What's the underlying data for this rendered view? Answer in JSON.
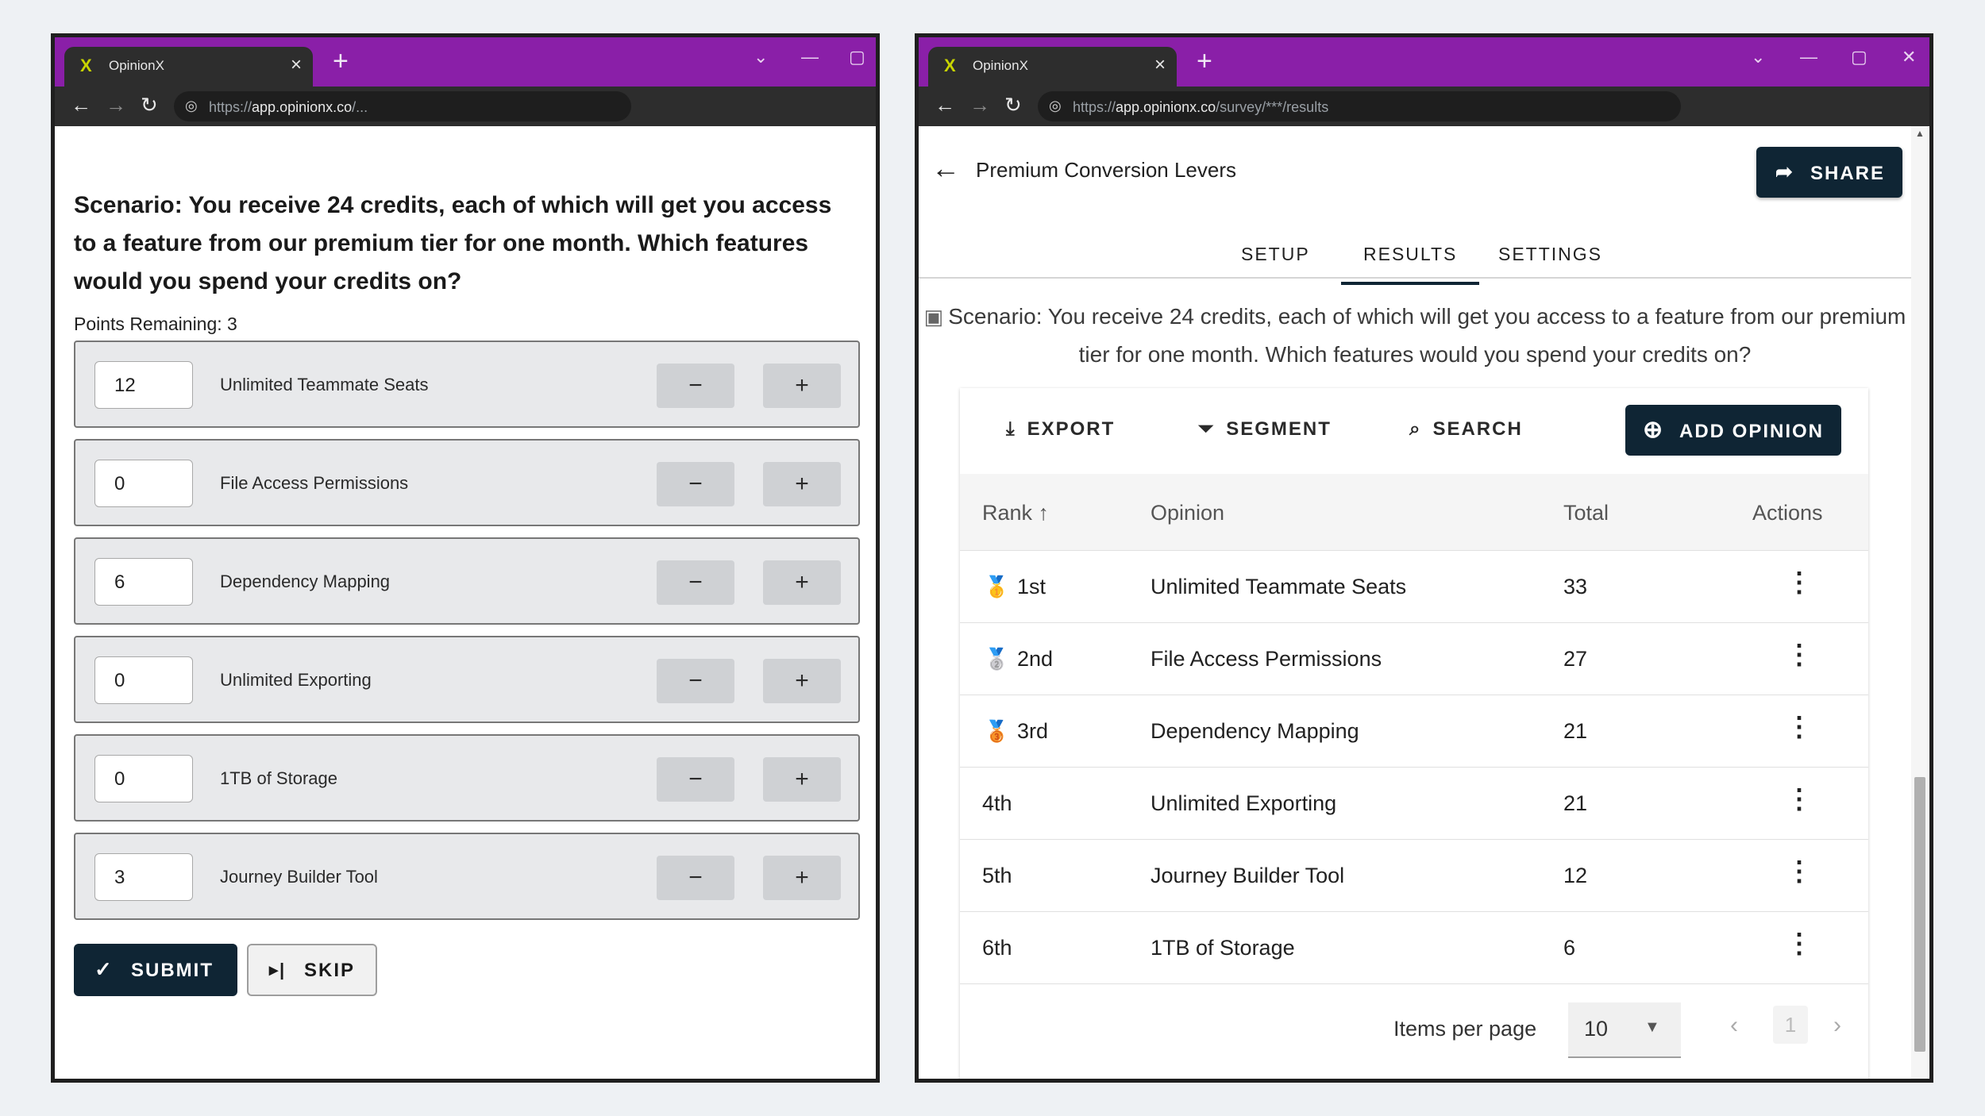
{
  "browser_left": {
    "tab_title": "OpinionX",
    "url_scheme": "https://",
    "url_host": "app.opinionx.co",
    "url_rest": "/..."
  },
  "survey": {
    "question": "Scenario: You receive 24 credits, each of which will get you access to a feature from our premium tier for one month. Which features would you spend your credits on?",
    "points_remaining": "Points Remaining: 3",
    "options": [
      {
        "value": "12",
        "label": "Unlimited Teammate Seats"
      },
      {
        "value": "0",
        "label": "File Access Permissions"
      },
      {
        "value": "6",
        "label": "Dependency Mapping"
      },
      {
        "value": "0",
        "label": "Unlimited Exporting"
      },
      {
        "value": "0",
        "label": "1TB of Storage"
      },
      {
        "value": "3",
        "label": "Journey Builder Tool"
      }
    ],
    "minus_label": "−",
    "plus_label": "+",
    "submit_label": "SUBMIT",
    "skip_label": "SKIP"
  },
  "browser_right": {
    "tab_title": "OpinionX",
    "url_scheme": "https://",
    "url_host": "app.opinionx.co",
    "url_rest": "/survey/***/results"
  },
  "results": {
    "title": "Premium Conversion Levers",
    "share_label": "SHARE",
    "tabs": [
      "SETUP",
      "RESULTS",
      "SETTINGS"
    ],
    "active_tab": "RESULTS",
    "scenario": "Scenario: You receive 24 credits, each of which will get you access to a feature from our premium tier for one month. Which features would you spend your credits on?",
    "actions": {
      "export": "EXPORT",
      "segment": "SEGMENT",
      "search": "SEARCH",
      "add_opinion": "ADD OPINION"
    },
    "columns": {
      "rank": "Rank",
      "opinion": "Opinion",
      "total": "Total",
      "actions": "Actions"
    },
    "rows": [
      {
        "rank": "1st",
        "opinion": "Unlimited Teammate Seats",
        "total": "33",
        "medal": "gold-medal-icon"
      },
      {
        "rank": "2nd",
        "opinion": "File Access Permissions",
        "total": "27",
        "medal": "silver-medal-icon"
      },
      {
        "rank": "3rd",
        "opinion": "Dependency Mapping",
        "total": "21",
        "medal": "bronze-medal-icon"
      },
      {
        "rank": "4th",
        "opinion": "Unlimited Exporting",
        "total": "21"
      },
      {
        "rank": "5th",
        "opinion": "Journey Builder Tool",
        "total": "12"
      },
      {
        "rank": "6th",
        "opinion": "1TB of Storage",
        "total": "6"
      }
    ],
    "items_per_page_label": "Items per page",
    "items_per_page": "10",
    "page": "1"
  },
  "colors": {
    "titlebar": "#8a1fa8",
    "primary_button": "#0f2534"
  }
}
